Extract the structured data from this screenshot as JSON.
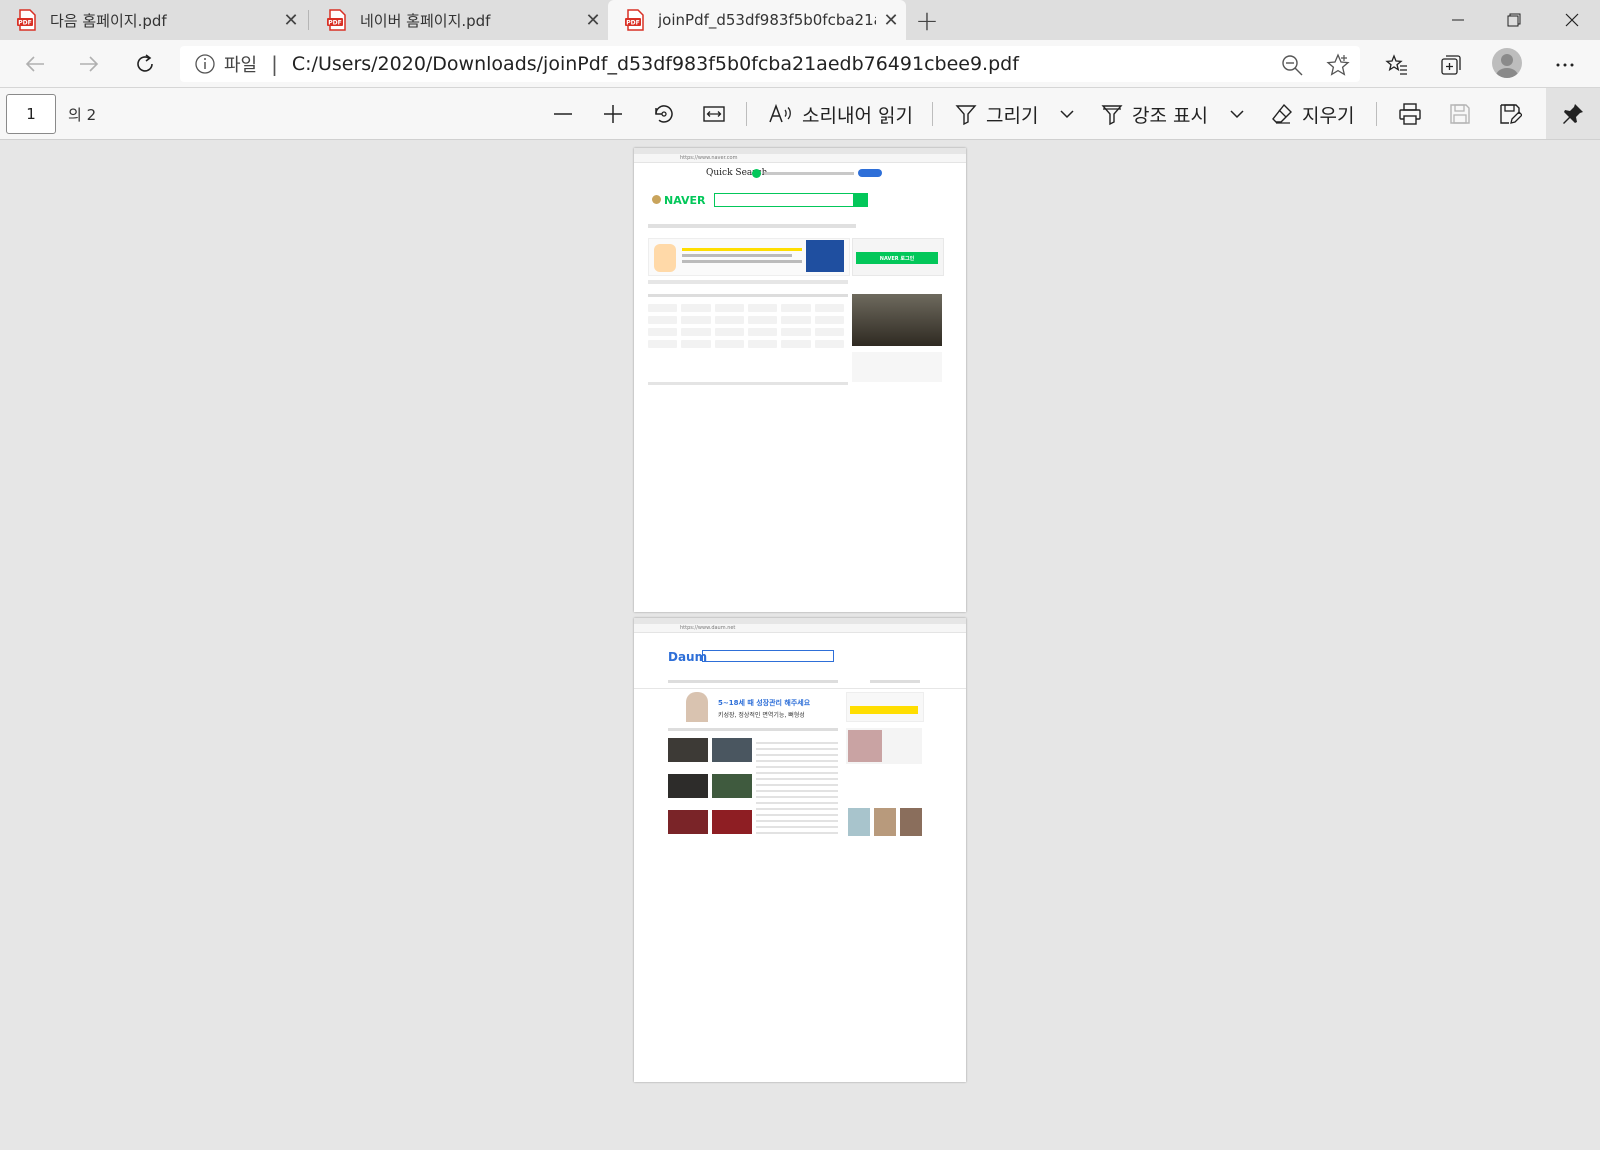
{
  "tabs": [
    {
      "title": "다음 홈페이지.pdf",
      "active": false
    },
    {
      "title": "네이버 홈페이지.pdf",
      "active": false
    },
    {
      "title": "joinPdf_d53df983f5b0fcba21aed",
      "active": true
    }
  ],
  "address": {
    "scheme_label": "파일",
    "url": "C:/Users/2020/Downloads/joinPdf_d53df983f5b0fcba21aedb76491cbee9.pdf"
  },
  "pdf_toolbar": {
    "page_number": "1",
    "page_of": "의 2",
    "read_aloud": "소리내어 읽기",
    "draw": "그리기",
    "highlight": "강조 표시",
    "erase": "지우기"
  },
  "pages": {
    "page1": {
      "url": "https://www.naver.com",
      "quick_search": "Quick Search",
      "logo": "NAVER",
      "login_button": "NAVER 로그인"
    },
    "page2": {
      "url": "https://www.daum.net",
      "logo": "Daum",
      "ad_headline": "5~18세 때 성장관리 해주세요",
      "ad_sub": "키성장, 정상적인 면역기능, 뼈형성"
    }
  },
  "colors": {
    "naver_green": "#03c75a",
    "daum_blue": "#2e6fd8",
    "pdf_red": "#d93025",
    "accent_yellow": "#ffde00"
  }
}
